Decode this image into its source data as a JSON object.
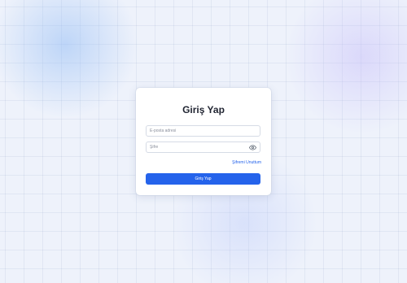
{
  "login": {
    "title": "Giriş Yap",
    "email": {
      "value": "",
      "placeholder": "E-posta adresi"
    },
    "password": {
      "value": "",
      "placeholder": "Şifre",
      "toggle_icon": "eye-icon"
    },
    "forgot_link": "Şifremi Unuttum",
    "submit_label": "Giriş Yap"
  },
  "colors": {
    "accent": "#2563eb",
    "card_background": "#ffffff",
    "page_background": "#eef2fb"
  }
}
